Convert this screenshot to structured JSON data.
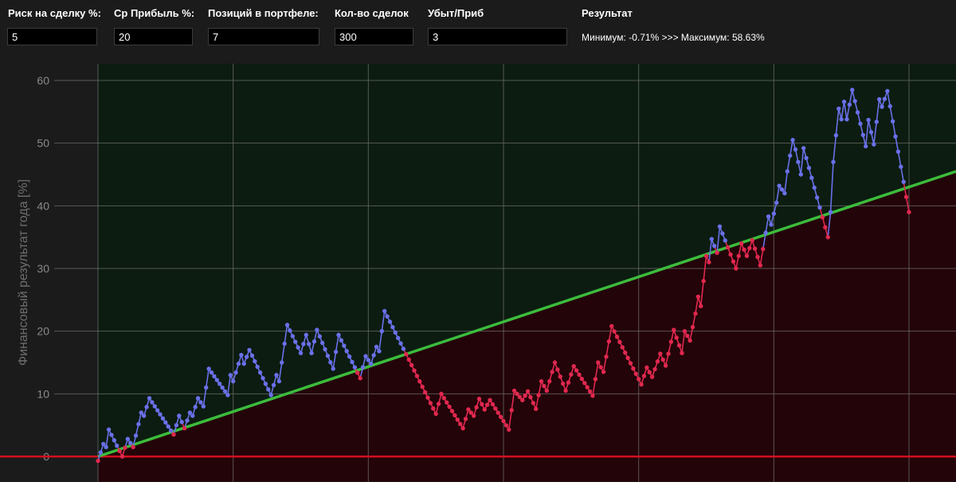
{
  "params": [
    {
      "label": "Риск на сделку %:",
      "value": "5"
    },
    {
      "label": "Ср Прибыль %:",
      "value": "20"
    },
    {
      "label": "Позиций в портфеле:",
      "value": "7"
    },
    {
      "label": "Кол-во сделок",
      "value": "300"
    },
    {
      "label": "Убыт/Приб",
      "value": "3"
    }
  ],
  "result": {
    "label": "Результат",
    "text": "Минимум: -0.71% >>> Максимум: 58.63%"
  },
  "colors": {
    "background": "#1b1b1b",
    "profit_zone": "#0c1c10",
    "loss_zone": "#230409",
    "above_trend": "#6a70e8",
    "below_trend": "#e0284e",
    "trend_line": "#3cbc3c",
    "zero_line": "#d40f1e",
    "grid": "#6e6e6e"
  },
  "chart_data": {
    "type": "line",
    "title": "",
    "ylabel": "Финансовый результат года [%]",
    "xlabel": "",
    "ylim": [
      -4,
      60
    ],
    "xlim": [
      0,
      300
    ],
    "yticks": [
      0,
      10,
      20,
      30,
      40,
      50,
      60
    ],
    "grid": true,
    "trend_line": {
      "start": 0,
      "end": 43
    },
    "zero_line": 0,
    "equity_keypoints": [
      [
        0,
        -0.7
      ],
      [
        2,
        2
      ],
      [
        3,
        1.5
      ],
      [
        4,
        4.3
      ],
      [
        9,
        0
      ],
      [
        11,
        2.8
      ],
      [
        13,
        1.5
      ],
      [
        16,
        7
      ],
      [
        17,
        6.5
      ],
      [
        19,
        9.3
      ],
      [
        28,
        3.5
      ],
      [
        30,
        6.5
      ],
      [
        32,
        4.5
      ],
      [
        34,
        7
      ],
      [
        35,
        6.5
      ],
      [
        37,
        9.3
      ],
      [
        39,
        8
      ],
      [
        41,
        14
      ],
      [
        48,
        9.8
      ],
      [
        49,
        13
      ],
      [
        50,
        12
      ],
      [
        53,
        16.2
      ],
      [
        54,
        14.8
      ],
      [
        56,
        17
      ],
      [
        64,
        9.8
      ],
      [
        66,
        13
      ],
      [
        67,
        12
      ],
      [
        70,
        21
      ],
      [
        75,
        16.5
      ],
      [
        77,
        19.4
      ],
      [
        79,
        16.5
      ],
      [
        81,
        20.2
      ],
      [
        87,
        14
      ],
      [
        89,
        19.4
      ],
      [
        97,
        12.5
      ],
      [
        99,
        16
      ],
      [
        101,
        14.8
      ],
      [
        103,
        17.5
      ],
      [
        104,
        16.8
      ],
      [
        106,
        23.2
      ],
      [
        108,
        21.5
      ],
      [
        125,
        6.8
      ],
      [
        127,
        10
      ],
      [
        135,
        4.5
      ],
      [
        137,
        7.5
      ],
      [
        139,
        6.5
      ],
      [
        141,
        9.2
      ],
      [
        143,
        7.5
      ],
      [
        145,
        9
      ],
      [
        152,
        4.3
      ],
      [
        154,
        10.5
      ],
      [
        157,
        9
      ],
      [
        159,
        10.4
      ],
      [
        162,
        7.6
      ],
      [
        164,
        12
      ],
      [
        166,
        10.5
      ],
      [
        169,
        15
      ],
      [
        173,
        10.5
      ],
      [
        176,
        14.4
      ],
      [
        183,
        9.7
      ],
      [
        185,
        15
      ],
      [
        187,
        13.5
      ],
      [
        190,
        20.8
      ],
      [
        201,
        11.5
      ],
      [
        203,
        14.2
      ],
      [
        205,
        12.7
      ],
      [
        208,
        16.4
      ],
      [
        210,
        14.5
      ],
      [
        213,
        20.2
      ],
      [
        216,
        16.5
      ],
      [
        217,
        20
      ],
      [
        219,
        18.5
      ],
      [
        221,
        22.8
      ],
      [
        222,
        25.5
      ],
      [
        223,
        24
      ],
      [
        224,
        28
      ],
      [
        225,
        32
      ],
      [
        226,
        31
      ],
      [
        227,
        34.7
      ],
      [
        229,
        32.5
      ],
      [
        230,
        36.7
      ],
      [
        236,
        30
      ],
      [
        238,
        34
      ],
      [
        240,
        32
      ],
      [
        242,
        34.5
      ],
      [
        245,
        30.5
      ],
      [
        248,
        38.3
      ],
      [
        249,
        37
      ],
      [
        251,
        40.5
      ],
      [
        252,
        43.2
      ],
      [
        254,
        42
      ],
      [
        255,
        45.5
      ],
      [
        257,
        50.5
      ],
      [
        258,
        49
      ],
      [
        260,
        45
      ],
      [
        261,
        49.2
      ],
      [
        270,
        35
      ],
      [
        271,
        39
      ],
      [
        272,
        47
      ],
      [
        274,
        55.5
      ],
      [
        275,
        53.8
      ],
      [
        276,
        56.6
      ],
      [
        277,
        53.8
      ],
      [
        279,
        58.5
      ],
      [
        284,
        49.5
      ],
      [
        285,
        53.7
      ],
      [
        287,
        49.8
      ],
      [
        289,
        57
      ],
      [
        290,
        55.8
      ],
      [
        292,
        58.3
      ],
      [
        300,
        39
      ]
    ]
  }
}
